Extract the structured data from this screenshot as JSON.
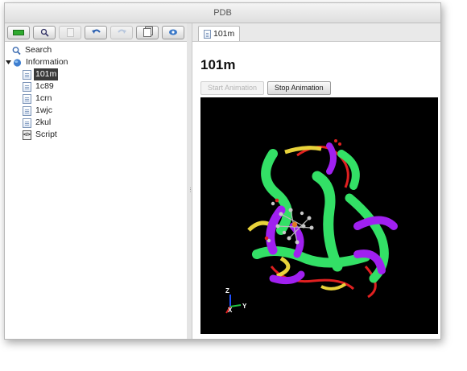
{
  "window": {
    "title": "PDB"
  },
  "toolbar": {
    "buttons": [
      {
        "icon": "minus-icon",
        "enabled": true
      },
      {
        "icon": "search-icon",
        "enabled": true
      },
      {
        "icon": "document-icon",
        "enabled": false
      },
      {
        "icon": "undo-icon",
        "enabled": true
      },
      {
        "icon": "redo-icon",
        "enabled": false
      },
      {
        "icon": "copy-icon",
        "enabled": true
      },
      {
        "icon": "view-icon",
        "enabled": true
      }
    ]
  },
  "tree": {
    "search": "Search",
    "information": "Information",
    "items": [
      "101m",
      "1c89",
      "1crn",
      "1wjc",
      "2kul"
    ],
    "selected": "101m",
    "script": "Script"
  },
  "tab": {
    "label": "101m"
  },
  "document": {
    "title": "101m",
    "start_animation": "Start Animation",
    "stop_animation": "Stop Animation"
  },
  "axes": {
    "z": "Z",
    "x": "X",
    "y": "Y"
  },
  "colors": {
    "helix_green": "#33e066",
    "helix_purple": "#a020f0",
    "sheet_yellow": "#e8d23a",
    "coil_red": "#e02020"
  }
}
